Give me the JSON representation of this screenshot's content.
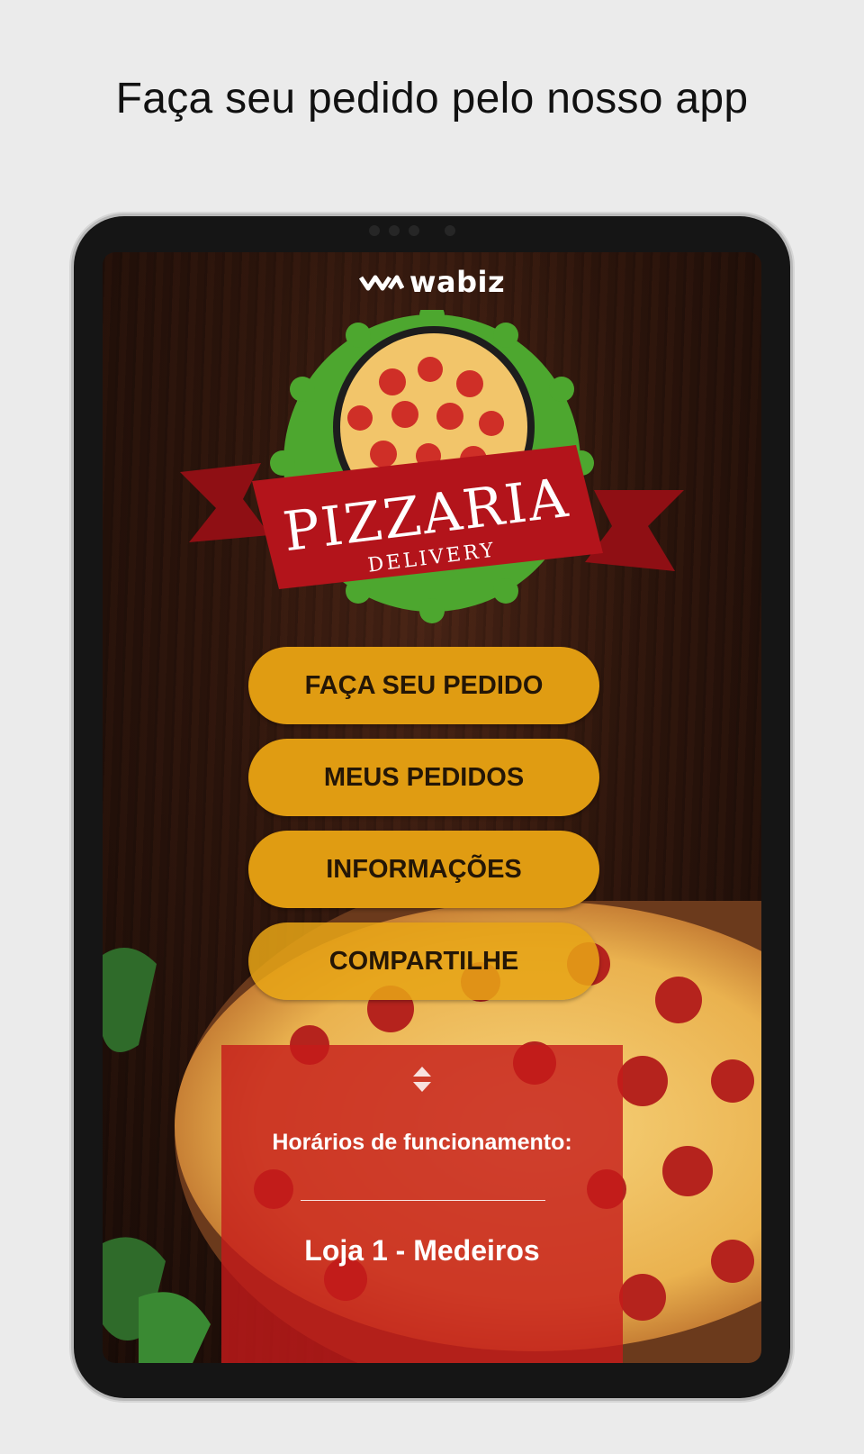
{
  "headline": "Faça seu pedido pelo nosso app",
  "brand": {
    "name": "wabiz",
    "icon": "wabiz-logo-icon"
  },
  "logo": {
    "title": "PIZZARIA",
    "subtitle": "DELIVERY",
    "colors": {
      "badge": "#4da72f",
      "ribbon": "#b3141b",
      "pizza": "#f2c56a"
    }
  },
  "menu": {
    "items": [
      {
        "label": "FAÇA SEU PEDIDO"
      },
      {
        "label": "MEUS PEDIDOS"
      },
      {
        "label": "INFORMAÇÕES"
      },
      {
        "label": "COMPARTILHE"
      }
    ]
  },
  "hours": {
    "title": "Horários de funcionamento:",
    "store": "Loja 1 - Medeiros"
  },
  "colors": {
    "button": "#e09c12",
    "button_text": "#241606",
    "panel": "#c61a1a",
    "background": "#ebebeb"
  }
}
